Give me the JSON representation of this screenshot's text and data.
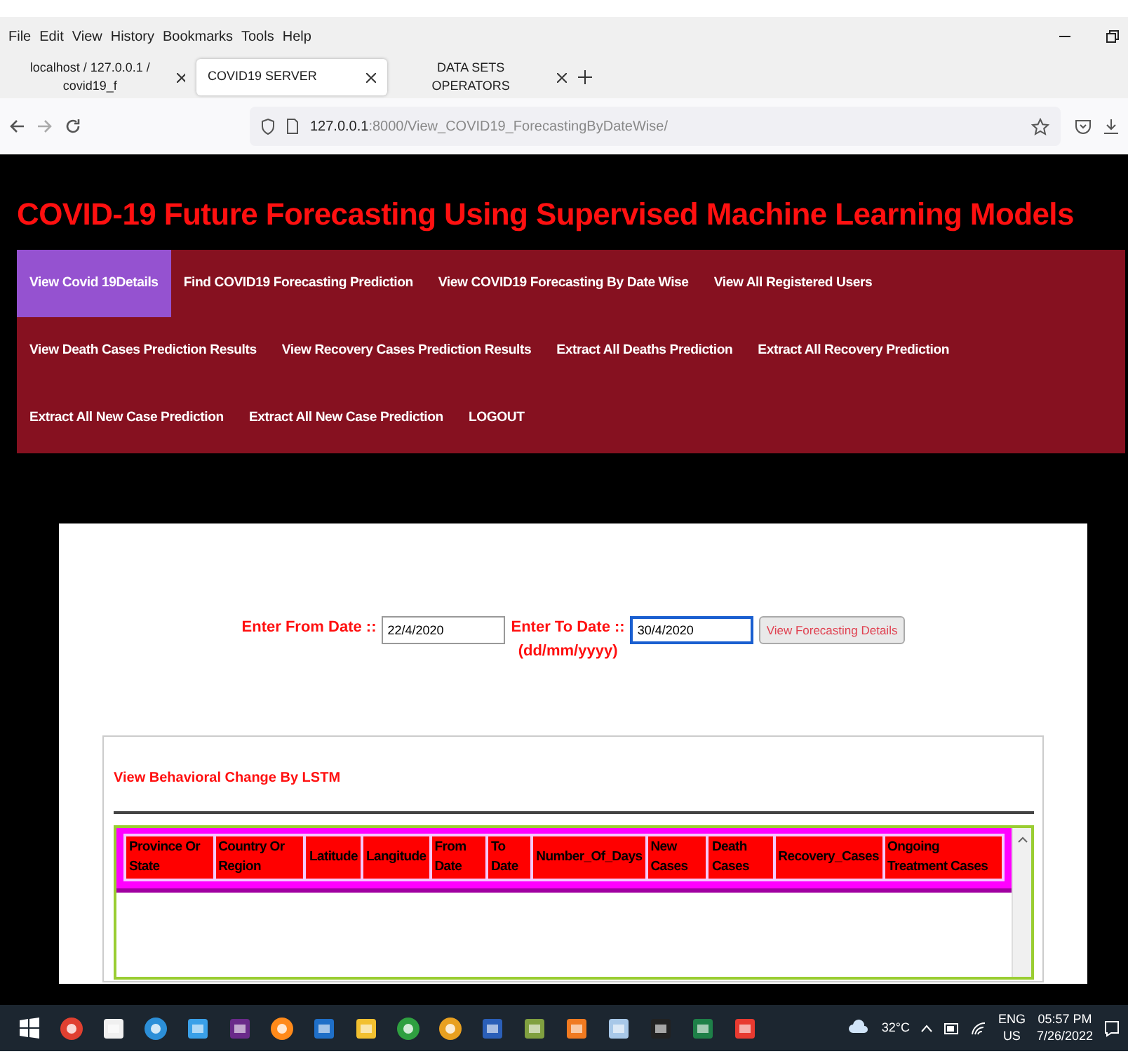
{
  "menu_bar": [
    "File",
    "Edit",
    "View",
    "History",
    "Bookmarks",
    "Tools",
    "Help"
  ],
  "browser_tabs": [
    {
      "label": "localhost / 127.0.0.1 / covid19_f",
      "selected": false
    },
    {
      "label": "COVID19 SERVER",
      "selected": true
    },
    {
      "label": "DATA SETS OPERATORS",
      "selected": false
    }
  ],
  "address_bar": {
    "host": "127.0.0.1",
    "path": ":8000/View_COVID19_ForecastingByDateWise/"
  },
  "page_title": "COVID-19 Future Forecasting Using Supervised Machine Learning Models",
  "nav_items": [
    {
      "label": "View Covid 19Details",
      "selected": true
    },
    {
      "label": "Find COVID19 Forecasting Prediction",
      "selected": false
    },
    {
      "label": "View COVID19 Forecasting By Date Wise",
      "selected": false
    },
    {
      "label": "View All Registered Users",
      "selected": false
    },
    {
      "label": "View Death Cases Prediction Results",
      "selected": false
    },
    {
      "label": "View Recovery Cases Prediction Results",
      "selected": false
    },
    {
      "label": "Extract All Deaths Prediction",
      "selected": false
    },
    {
      "label": "Extract All Recovery Prediction",
      "selected": false
    },
    {
      "label": "Extract All New Case Prediction",
      "selected": false
    },
    {
      "label": "Extract All New Case Prediction",
      "selected": false
    },
    {
      "label": "LOGOUT",
      "selected": false
    }
  ],
  "form": {
    "from_label": "Enter From Date ::",
    "from_value": "22/4/2020",
    "to_label": "Enter To Date ::",
    "to_value": "30/4/2020",
    "format_hint": "(dd/mm/yyyy)",
    "button": "View Forecasting Details"
  },
  "section_title": "View Behavioral Change By LSTM",
  "table": {
    "columns": [
      "Province Or State",
      "Country Or Region",
      "Latitude",
      "Langitude",
      "From Date",
      "To Date",
      "Number_Of_Days",
      "New Cases",
      "Death Cases",
      "Recovery_Cases",
      "Ongoing Treatment Cases"
    ]
  },
  "taskbar": {
    "weather": "32°C",
    "language": "ENG",
    "region": "US",
    "time": "05:57 PM",
    "date": "7/26/2022"
  }
}
